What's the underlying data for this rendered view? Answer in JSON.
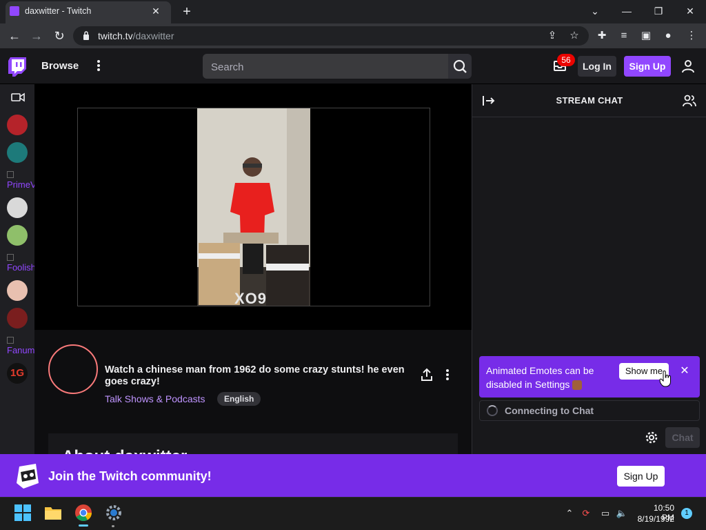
{
  "browser": {
    "tab_title": "daxwitter - Twitch",
    "url_host": "twitch.tv",
    "url_path": "/daxwitter"
  },
  "twitch_nav": {
    "browse_label": "Browse",
    "search_placeholder": "Search",
    "inbox_count": "56",
    "login_label": "Log In",
    "signup_label": "Sign Up"
  },
  "sidebar": {
    "items": [
      {
        "type": "avatar",
        "color": "#b5232a"
      },
      {
        "type": "avatar",
        "color": "#1d7a7a"
      },
      {
        "type": "broken",
        "label": "PrimeV"
      },
      {
        "type": "avatar",
        "color": "#d9d9d9"
      },
      {
        "type": "avatar",
        "color": "#8fbf6a"
      },
      {
        "type": "broken",
        "label": "Foolish"
      },
      {
        "type": "avatar",
        "color": "#e8c0b0"
      },
      {
        "type": "avatar",
        "color": "#7a1e1e"
      },
      {
        "type": "broken",
        "label": "Fanum"
      },
      {
        "type": "logo",
        "label": "1G",
        "color": "#e43b2c"
      }
    ]
  },
  "channel": {
    "stream_title": "Watch a chinese man from 1962 do some crazy stunts! he even goes crazy!",
    "category": "Talk Shows & Podcasts",
    "language_tag": "English",
    "about_title": "About daxwitter"
  },
  "video": {
    "overlay_text": "XO9"
  },
  "chat": {
    "title": "STREAM CHAT",
    "emote_banner_text": "Animated Emotes can be disabled in Settings",
    "show_me_label": "Show me",
    "connecting_text": "Connecting to Chat",
    "chat_button_label": "Chat"
  },
  "join_banner": {
    "text": "Join the Twitch community!",
    "signup_label": "Sign Up"
  },
  "taskbar": {
    "time": "10:50 PM",
    "date": "8/19/1992",
    "notification_count": "1"
  },
  "colors": {
    "twitch_purple": "#9147ff",
    "banner_purple": "#772ce8",
    "badge_red": "#eb0400"
  }
}
